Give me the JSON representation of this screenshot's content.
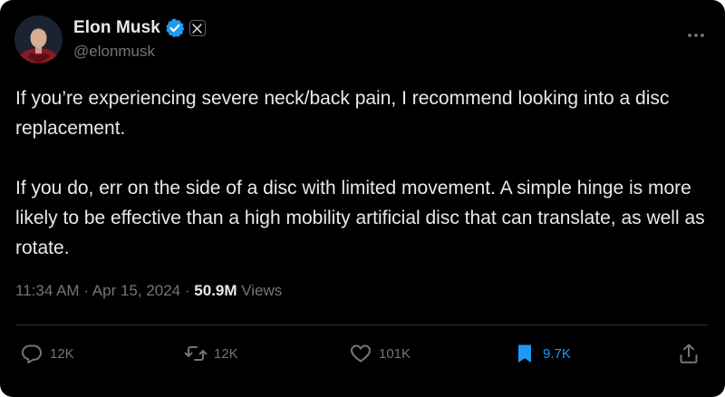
{
  "author": {
    "display_name": "Elon Musk",
    "handle": "@elonmusk",
    "verified_icon": "verified-badge-icon",
    "affiliate_icon": "x-logo-icon"
  },
  "tweet": {
    "paragraphs": [
      "If you’re experiencing severe neck/back pain, I recommend looking into a disc replacement.",
      "If you do, err on the side of a disc with limited movement. A simple hinge is more likely to be effective than a high mobility artificial disc that can translate, as well as rotate."
    ],
    "time": "11:34 AM",
    "separator": "·",
    "date": "Apr 15, 2024",
    "views_count": "50.9M",
    "views_label": "Views"
  },
  "actions": {
    "replies": "12K",
    "reposts": "12K",
    "likes": "101K",
    "bookmarks": "9.7K"
  },
  "colors": {
    "background": "#000000",
    "text_primary": "#e7e9ea",
    "text_secondary": "#71767b",
    "accent": "#1d9bf0",
    "divider": "#2f3336"
  }
}
